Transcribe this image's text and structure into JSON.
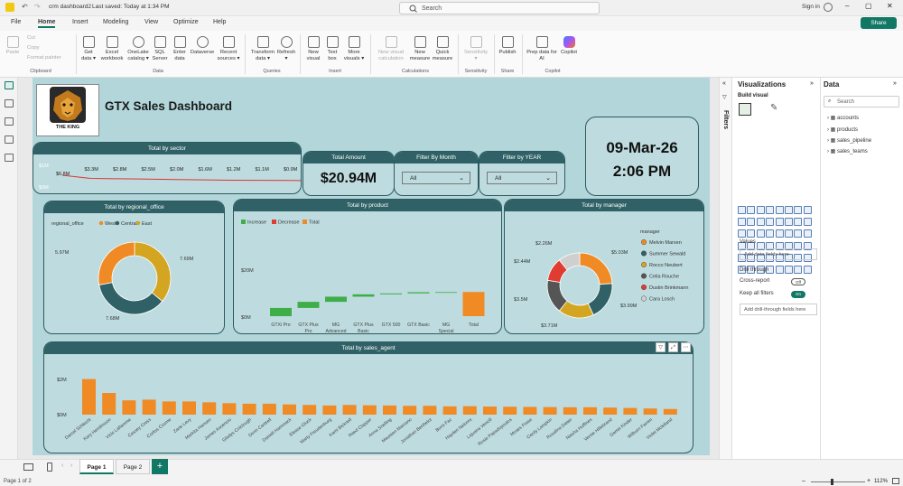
{
  "titlebar": {
    "file_name": "crm dashboard2",
    "saved": "Last saved: Today at 1:34 PM",
    "search": "Search",
    "sign_in": "Sign in"
  },
  "menu": [
    "File",
    "Home",
    "Insert",
    "Modeling",
    "View",
    "Optimize",
    "Help"
  ],
  "share_label": "Share",
  "ribbon": {
    "paste": "Paste",
    "cut": "Cut",
    "copy": "Copy",
    "format_painter": "Format painter",
    "buttons": [
      {
        "line1": "Get",
        "line2": "data"
      },
      {
        "line1": "Excel",
        "line2": "workbook"
      },
      {
        "line1": "OneLake",
        "line2": "catalog"
      },
      {
        "line1": "SQL",
        "line2": "Server"
      },
      {
        "line1": "Enter",
        "line2": "data"
      },
      {
        "line1": "Dataverse",
        "line2": ""
      },
      {
        "line1": "Recent",
        "line2": "sources"
      },
      {
        "line1": "Transform",
        "line2": "data"
      },
      {
        "line1": "Refresh",
        "line2": ""
      },
      {
        "line1": "New",
        "line2": "visual"
      },
      {
        "line1": "Text",
        "line2": "box"
      },
      {
        "line1": "More",
        "line2": "visuals"
      },
      {
        "line1": "New visual",
        "line2": "calculation"
      },
      {
        "line1": "New",
        "line2": "measure"
      },
      {
        "line1": "Quick",
        "line2": "measure"
      },
      {
        "line1": "Sensitivity",
        "line2": ""
      },
      {
        "line1": "Publish",
        "line2": ""
      },
      {
        "line1": "Prep data for",
        "line2": "AI"
      },
      {
        "line1": "Copilot",
        "line2": ""
      }
    ],
    "groups": [
      "Clipboard",
      "Data",
      "Queries",
      "Insert",
      "Calculations",
      "Sensitivity",
      "Share",
      "Copilot"
    ]
  },
  "logo_text": "THE KING",
  "dashboard_title": "GTX Sales Dashboard",
  "sector": {
    "header": "Total by sector",
    "axis_top": "$1M",
    "axis_bottom": "$0M",
    "labels": [
      "$6.8M",
      "$3.3M",
      "$2.8M",
      "$2.5M",
      "$2.0M",
      "$1.6M",
      "$1.2M",
      "$1.1M",
      "$0.9M",
      "$0.7M"
    ]
  },
  "amount": {
    "header": "Total Amount",
    "value": "$20.94M"
  },
  "month": {
    "header": "Filter By Month",
    "selected": "All"
  },
  "year": {
    "header": "Filter by YEAR",
    "selected": "All"
  },
  "clock": {
    "date": "09-Mar-26",
    "time": "2:06 PM"
  },
  "regional": {
    "header": "Total by regional_office",
    "legend_title": "regional_office",
    "legend": [
      "West",
      "Central",
      "East"
    ],
    "labels": [
      "5.97M",
      "7.69M",
      "7.68M"
    ]
  },
  "product": {
    "header": "Total by product",
    "legend": [
      "Increase",
      "Decrease",
      "Total"
    ],
    "y_ticks": [
      "$20M",
      "$0M"
    ],
    "categories": [
      "GTXi Pro",
      "GTX Plus Pro",
      "MG Advanced",
      "GTX Plus Basic",
      "GTX 500",
      "GTX Basic",
      "MG Special",
      "Total"
    ]
  },
  "manager": {
    "header": "Total by manager",
    "legend_title": "manager",
    "legend": [
      "Melvin Marxen",
      "Summer Sewald",
      "Rocco Neubert",
      "Celia Rouche",
      "Dustin Brinkmann",
      "Cara Losch"
    ],
    "labels": [
      "$2.26M",
      "$5.03M",
      "$2.44M",
      "$3.5M",
      "$3.71M",
      "$3.99M"
    ]
  },
  "agent": {
    "header": "Total by sales_agent",
    "y_ticks": [
      "$2M",
      "$0M"
    ],
    "names": [
      "Darcel Schlecht",
      "Kary Hendrixson",
      "Vicki Laflamme",
      "Cassey Cress",
      "Corliss Cosme",
      "Zane Levy",
      "Markita Hansen",
      "James Ascencio",
      "Gladys Colclough",
      "Donn Cantrell",
      "Daniell Hammack",
      "Elease Gluck",
      "Marty Freudenburg",
      "Kami Bicknell",
      "Reed Clapper",
      "Anna Snelling",
      "Maureen Marcano",
      "Jonathan Berthelot",
      "Boris Faz",
      "Hayden Neloms",
      "Lajuana Vencill",
      "Rosie Papadopoulos",
      "Moses Frase",
      "Cecily Lampkin",
      "Rosalina Dieter",
      "Niesha Huffines",
      "Versie Hillebrand",
      "Garret Kinder",
      "Wilburn Farren",
      "Violet Mclelland"
    ]
  },
  "filters_label": "Filters",
  "viz": {
    "title": "Visualizations",
    "build": "Build visual",
    "values": "Values",
    "add_fields": "Add data fields here",
    "drill": "Drill through",
    "cross": "Cross-report",
    "cross_state": "Off",
    "keep": "Keep all filters",
    "keep_state": "On",
    "add_drill": "Add drill-through fields here"
  },
  "data_pane": {
    "title": "Data",
    "search": "Search",
    "tables": [
      "accounts",
      "products",
      "sales_pipeline",
      "sales_teams"
    ]
  },
  "status": {
    "page_info": "Page 1 of 2",
    "tabs": [
      "Page 1",
      "Page 2"
    ],
    "zoom": "112%"
  },
  "colors": {
    "teal": "#2f6166",
    "orange": "#f08a24",
    "yellow": "#d4a520",
    "green": "#3fae49",
    "red": "#e03c31",
    "gray": "#cfcfcf"
  },
  "chart_data": [
    {
      "type": "line",
      "title": "Total by sector",
      "values": [
        6.8,
        3.3,
        2.8,
        2.5,
        2.0,
        1.6,
        1.2,
        1.1,
        0.9,
        0.7
      ]
    },
    {
      "type": "pie",
      "title": "Total by regional_office",
      "series": [
        {
          "name": "West",
          "value": 5.97
        },
        {
          "name": "Central",
          "value": 7.68
        },
        {
          "name": "East",
          "value": 7.69
        }
      ]
    },
    {
      "type": "bar",
      "title": "Total by product",
      "categories": [
        "GTXi Pro",
        "GTX Plus Pro",
        "MG Advanced",
        "GTX Plus Basic",
        "GTX 500",
        "GTX Basic",
        "MG Special",
        "Total"
      ],
      "values": [
        3.5,
        2.6,
        2.2,
        1.0,
        0.4,
        0.5,
        0.05,
        10.3
      ],
      "ylim": [
        0,
        20
      ]
    },
    {
      "type": "pie",
      "title": "Total by manager",
      "series": [
        {
          "name": "Melvin Marxen",
          "value": 5.03
        },
        {
          "name": "Summer Sewald",
          "value": 3.99
        },
        {
          "name": "Rocco Neubert",
          "value": 3.71
        },
        {
          "name": "Celia Rouche",
          "value": 3.5
        },
        {
          "name": "Dustin Brinkmann",
          "value": 2.44
        },
        {
          "name": "Cara Losch",
          "value": 2.26
        }
      ]
    },
    {
      "type": "bar",
      "title": "Total by sales_agent",
      "values": [
        2.02,
        1.23,
        0.81,
        0.85,
        0.75,
        0.75,
        0.7,
        0.65,
        0.62,
        0.62,
        0.58,
        0.55,
        0.52,
        0.55,
        0.53,
        0.52,
        0.5,
        0.5,
        0.47,
        0.48,
        0.46,
        0.45,
        0.44,
        0.43,
        0.42,
        0.42,
        0.4,
        0.38,
        0.35,
        0.32
      ],
      "ylim": [
        0,
        2.5
      ]
    }
  ]
}
